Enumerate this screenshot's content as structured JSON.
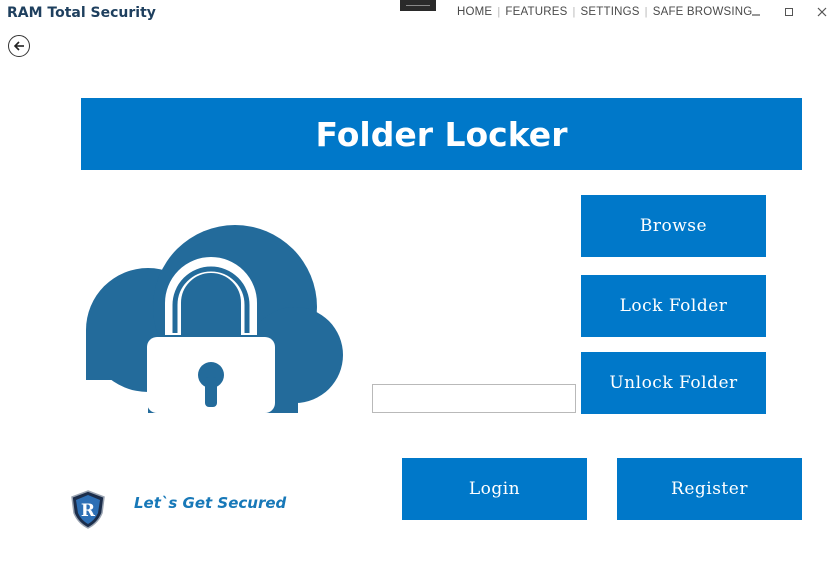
{
  "app": {
    "title": "RAM Total Security"
  },
  "nav": {
    "items": [
      {
        "label": "HOME"
      },
      {
        "label": "FEATURES"
      },
      {
        "label": "SETTINGS"
      },
      {
        "label": "SAFE BROWSING"
      }
    ],
    "separator": "|"
  },
  "window_controls": {
    "minimize": "–",
    "maximize": "☐",
    "close": "✕"
  },
  "back_button": {
    "icon": "back-arrow-icon"
  },
  "banner": {
    "title": "Folder Locker"
  },
  "hero": {
    "icon": "cloud-lock-icon"
  },
  "folder_path": {
    "value": "",
    "placeholder": ""
  },
  "buttons": {
    "browse": "Browse",
    "lock": "Lock Folder",
    "unlock": "Unlock Folder",
    "login": "Login",
    "register": "Register"
  },
  "footer": {
    "logo": "shield-logo-icon",
    "tagline": "Let`s Get Secured"
  },
  "colors": {
    "accent": "#0078c9",
    "hero_icon": "#236b9b",
    "title_text": "#1e3f5e",
    "tagline": "#1778b8"
  }
}
